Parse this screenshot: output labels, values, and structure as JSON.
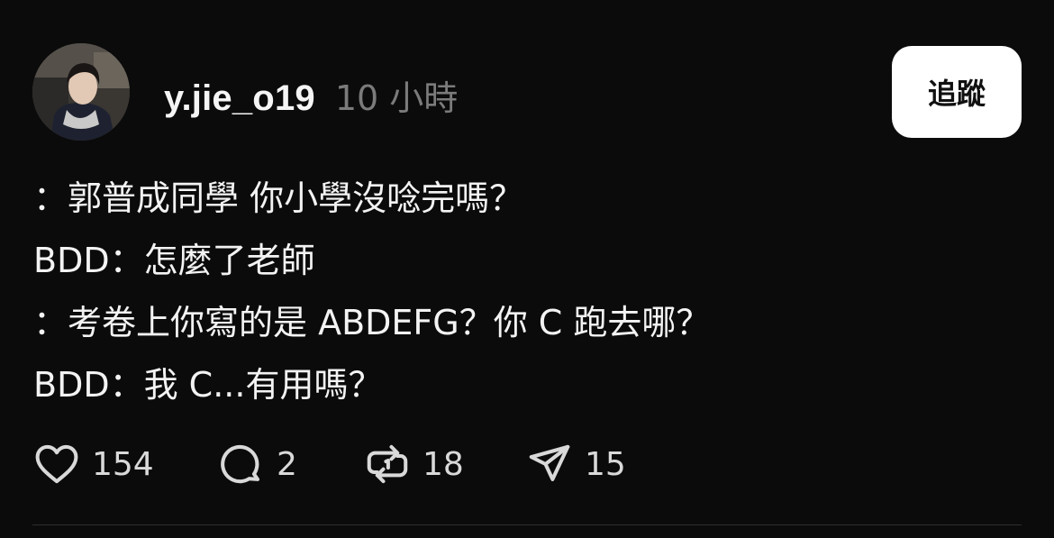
{
  "post": {
    "username": "y.jie_o19",
    "time": "10 小時",
    "follow_label": "追蹤",
    "lines": [
      "：郭普成同學 你小學沒唸完嗎？",
      "BDD：怎麼了老師",
      "：考卷上你寫的是 ABDEFG？你 C 跑去哪？",
      "BDD：我 C...有用嗎？"
    ]
  },
  "actions": {
    "like_count": "154",
    "comment_count": "2",
    "repost_count": "18",
    "share_count": "15"
  },
  "icons": {
    "like": "heart-icon",
    "comment": "comment-bubble-icon",
    "repost": "repost-icon",
    "share": "send-icon"
  },
  "colors": {
    "background": "#0b0b0b",
    "text": "#f3f3f3",
    "muted": "#7b7b7b",
    "button_bg": "#ffffff",
    "button_text": "#111111"
  }
}
